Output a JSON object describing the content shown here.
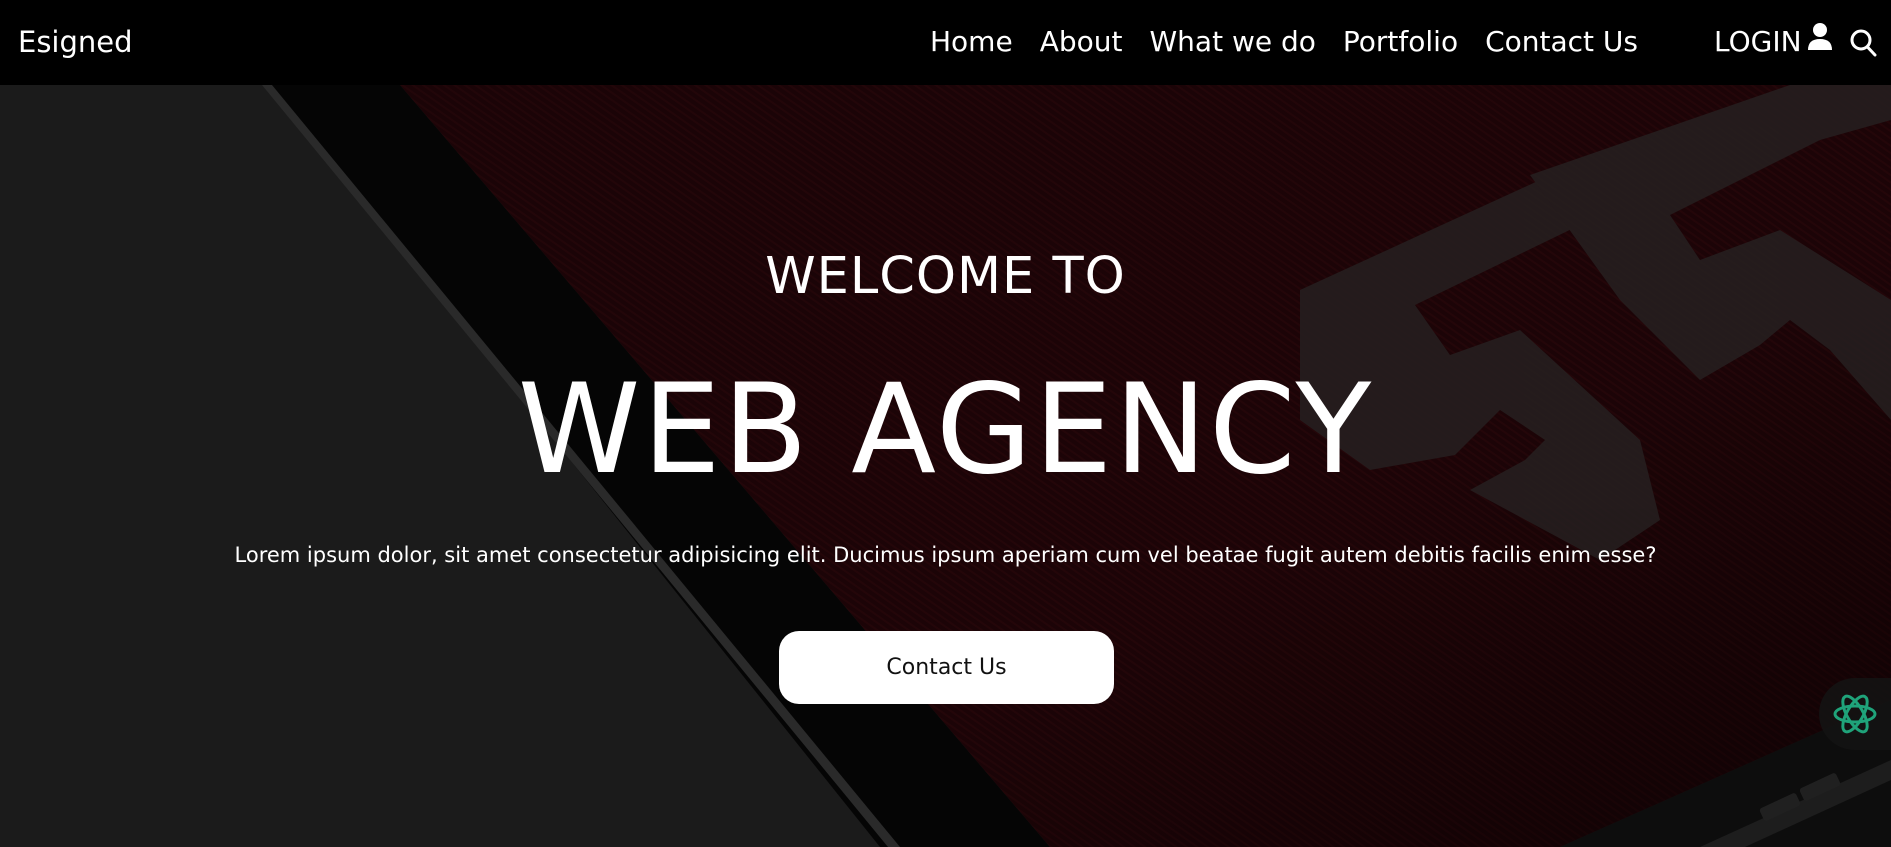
{
  "navbar": {
    "brand": "Esigned",
    "links": [
      {
        "label": "Home"
      },
      {
        "label": "About"
      },
      {
        "label": "What we do"
      },
      {
        "label": "Portfolio"
      },
      {
        "label": "Contact Us"
      }
    ],
    "login_label": "LOGIN",
    "icons": {
      "user": "user-icon",
      "search": "search-icon"
    }
  },
  "hero": {
    "welcome": "WELCOME TO",
    "headline": "WEB AGENCY",
    "lead": "Lorem ipsum dolor, sit amet consectetur adipisicing elit. Ducimus ipsum aperiam cum vel beatae fugit autem debitis facilis enim esse?",
    "cta_label": "Contact Us",
    "background_digits": "55"
  },
  "assistant": {
    "icon": "assistant-knot-icon",
    "color": "#1fa37a"
  },
  "colors": {
    "navbar_bg": "#000000",
    "text": "#ffffff",
    "hero_red": "#1d0507",
    "hero_dark": "#1b1b1b",
    "cta_bg": "#ffffff",
    "cta_text": "#111111"
  }
}
